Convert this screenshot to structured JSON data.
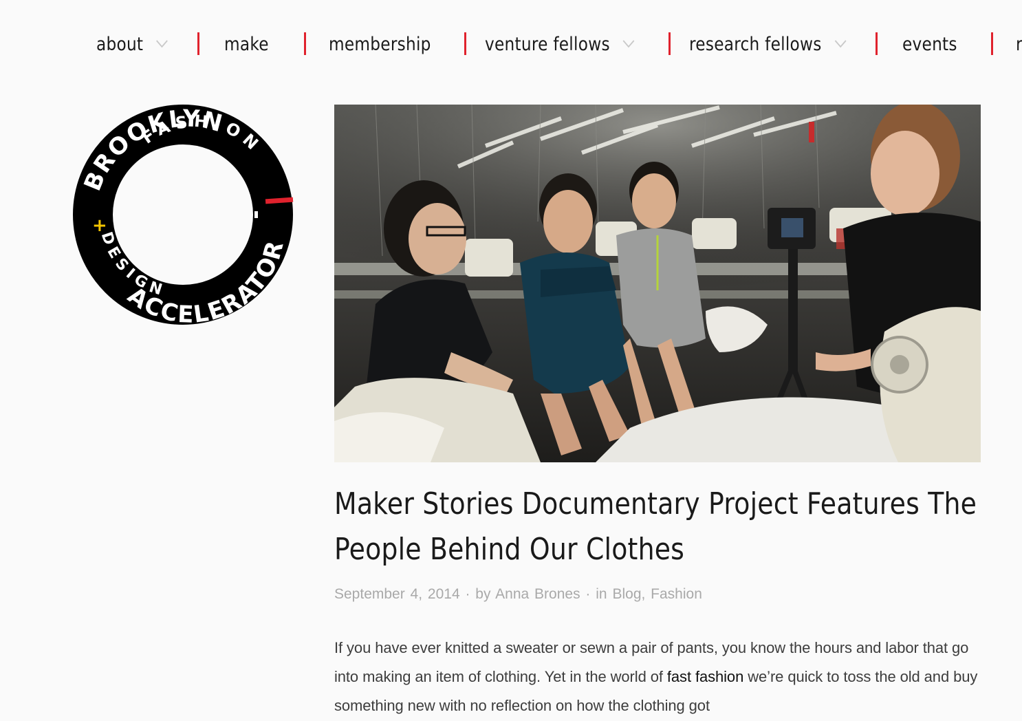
{
  "nav": {
    "items": [
      {
        "label": "about",
        "has_dropdown": true
      },
      {
        "label": "make",
        "has_dropdown": false
      },
      {
        "label": "membership",
        "has_dropdown": false
      },
      {
        "label": "venture fellows",
        "has_dropdown": true
      },
      {
        "label": "research fellows",
        "has_dropdown": true
      },
      {
        "label": "events",
        "has_dropdown": false
      },
      {
        "label": "r",
        "has_dropdown": false
      }
    ],
    "separator_color": "#e0222d",
    "chevron_icon": "chevron-down-icon"
  },
  "logo": {
    "line1": "BROOKLYN",
    "line2": "FASHION",
    "plus": "+",
    "line3": "DESIGN",
    "line4": "ACCELERATOR",
    "ring_color": "#000000",
    "accent_color": "#e0222d",
    "plus_color": "#f2c400"
  },
  "post": {
    "image_alt_icon": "photo-garment-factory",
    "title_line1": "Maker Stories Documentary Project Features The",
    "title_line2": "People Behind Our Clothes",
    "meta": {
      "date": "September 4, 2014",
      "by": "by",
      "author": "Anna Brones",
      "in": "in",
      "category1": "Blog",
      "category2": "Fashion"
    },
    "excerpt": {
      "part1": "If you have ever knitted a sweater or sewn a pair of pants, you know the hours and labor that go into making an item of clothing. Yet in the world of ",
      "link": "fast fashion",
      "part2": " we’re quick to toss the old and buy something new with no reflection on how the clothing got"
    }
  }
}
